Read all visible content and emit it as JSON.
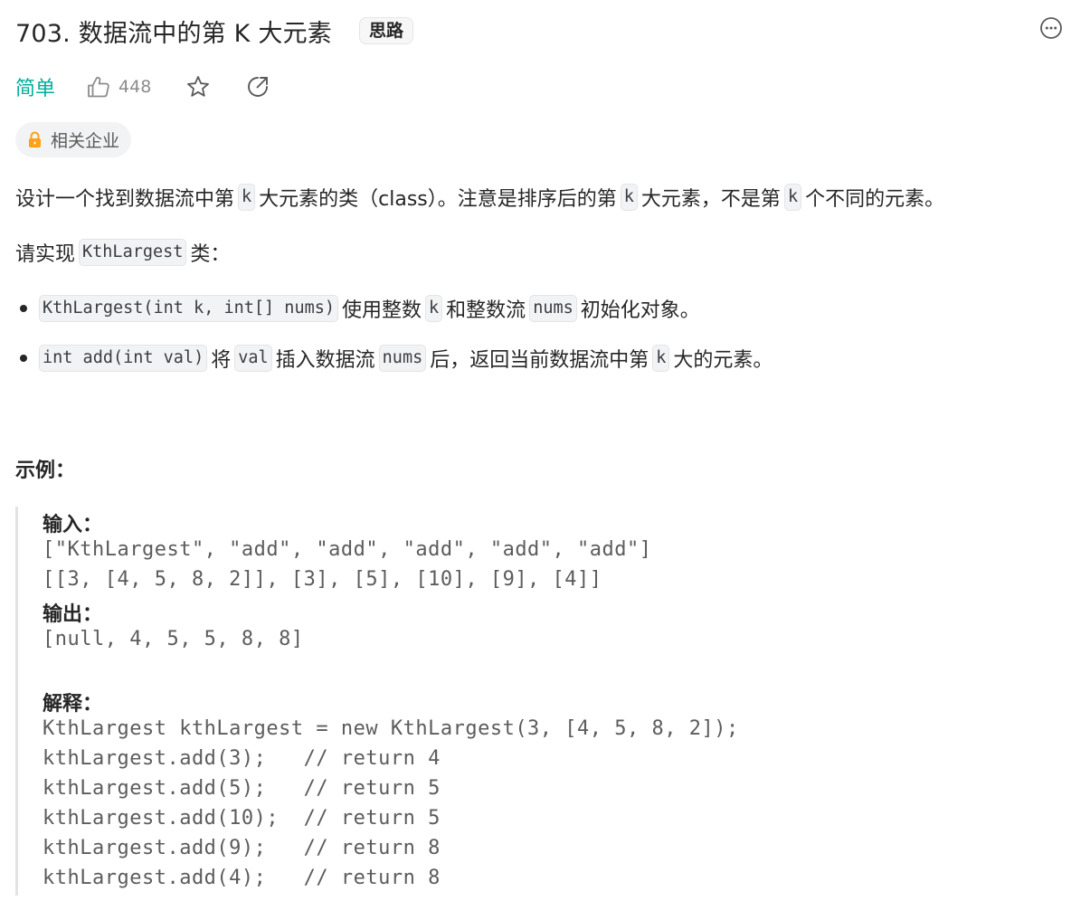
{
  "header": {
    "title": "703. 数据流中的第 K 大元素",
    "hint_tag": "思路",
    "more_icon": "ellipsis-circle-icon"
  },
  "meta": {
    "difficulty": "简单",
    "difficulty_color": "#00af9b",
    "like_count": "448",
    "like_icon": "thumbs-up-icon",
    "star_icon": "star-icon",
    "share_icon": "share-icon"
  },
  "company": {
    "label": "相关企业",
    "icon": "lock-icon",
    "icon_color": "#ffa116"
  },
  "description": {
    "p1": {
      "s1": "设计一个找到数据流中第",
      "c1": "k",
      "s2": "大元素的类（class）。注意是排序后的第",
      "c2": "k",
      "s3": "大元素，不是第",
      "c3": "k",
      "s4": "个不同的元素。"
    },
    "p2": {
      "s1": "请实现",
      "c1": "KthLargest",
      "s2": "类："
    },
    "li1": {
      "c1": "KthLargest(int k, int[] nums)",
      "s1": "使用整数",
      "c2": "k",
      "s2": "和整数流",
      "c3": "nums",
      "s3": "初始化对象。"
    },
    "li2": {
      "c1": "int add(int val)",
      "s1": "将",
      "c2": "val",
      "s2": "插入数据流",
      "c3": "nums",
      "s3": "后，返回当前数据流中第",
      "c4": "k",
      "s4": "大的元素。"
    }
  },
  "example": {
    "heading": "示例：",
    "input_label": "输入：",
    "input_line1": "[\"KthLargest\", \"add\", \"add\", \"add\", \"add\", \"add\"]",
    "input_line2": "[[3, [4, 5, 8, 2]], [3], [5], [10], [9], [4]]",
    "output_label": "输出：",
    "output_line": "[null, 4, 5, 5, 8, 8]",
    "explain_label": "解释：",
    "explain_lines": [
      "KthLargest kthLargest = new KthLargest(3, [4, 5, 8, 2]);",
      "kthLargest.add(3);   // return 4",
      "kthLargest.add(5);   // return 5",
      "kthLargest.add(10);  // return 5",
      "kthLargest.add(9);   // return 8",
      "kthLargest.add(4);   // return 8"
    ]
  }
}
